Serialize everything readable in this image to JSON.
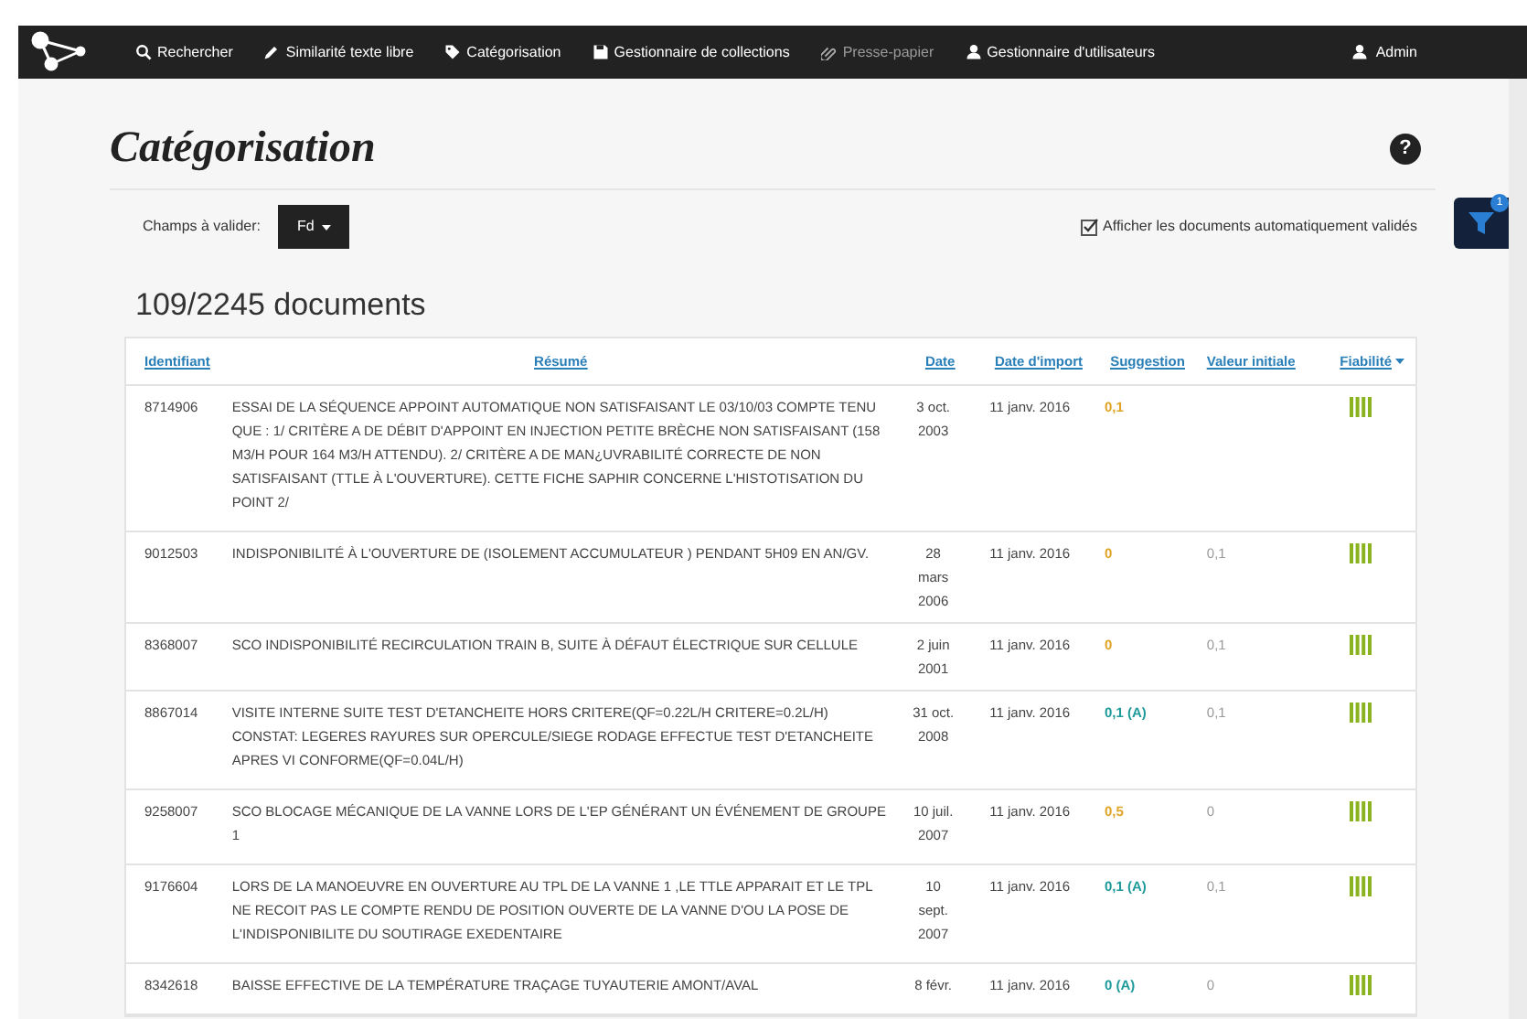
{
  "nav": {
    "items": [
      {
        "label": "Rechercher",
        "disabled": false
      },
      {
        "label": "Similarité texte libre",
        "disabled": false
      },
      {
        "label": "Catégorisation",
        "disabled": false
      },
      {
        "label": "Gestionnaire de collections",
        "disabled": false
      },
      {
        "label": "Presse-papier",
        "disabled": true
      },
      {
        "label": "Gestionnaire d'utilisateurs",
        "disabled": false
      }
    ],
    "user": "Admin"
  },
  "page": {
    "title": "Catégorisation",
    "help": "?"
  },
  "filters": {
    "label": "Champs à valider:",
    "dropdown": "Fd",
    "auto_validated": {
      "label": "Afficher les documents automatiquement validés",
      "checked": true
    }
  },
  "filter_badge": "1",
  "count": "109/2245 documents",
  "table": {
    "columns": [
      "Identifiant",
      "Résumé",
      "Date",
      "Date d'import",
      "Suggestion",
      "Valeur initiale",
      "Fiabilité"
    ],
    "rows": [
      {
        "id": "8714906",
        "summary": "ESSAI DE LA SÉQUENCE APPOINT AUTOMATIQUE NON SATISFAISANT LE 03/10/03 COMPTE TENU QUE : 1/ CRITÈRE A DE DÉBIT D'APPOINT EN INJECTION PETITE BRÈCHE NON SATISFAISANT (158 M3/H POUR 164 M3/H ATTENDU). 2/ CRITÈRE A DE MAN¿UVRABILITÉ CORRECTE DE NON SATISFAISANT (TTLE À L'OUVERTURE). CETTE FICHE SAPHIR CONCERNE L'HISTOTISATION DU POINT 2/",
        "date": "3 oct. 2003",
        "import": "11 janv. 2016",
        "suggestion": "0,1",
        "color": "#e0a526",
        "initial": null
      },
      {
        "id": "9012503",
        "summary": "INDISPONIBILITÉ À L'OUVERTURE DE (ISOLEMENT ACCUMULATEUR ) PENDANT 5H09 EN AN/GV.",
        "date": "28 mars 2006",
        "import": "11 janv. 2016",
        "suggestion": "0",
        "color": "#e0a526",
        "initial": "0,1"
      },
      {
        "id": "8368007",
        "summary": "SCO INDISPONIBILITÉ RECIRCULATION TRAIN B, SUITE À DÉFAUT ÉLECTRIQUE SUR CELLULE",
        "date": "2 juin 2001",
        "import": "11 janv. 2016",
        "suggestion": "0",
        "color": "#e0a526",
        "initial": "0,1"
      },
      {
        "id": "8867014",
        "summary": "VISITE INTERNE SUITE TEST D'ETANCHEITE HORS CRITERE(QF=0.22L/H CRITERE=0.2L/H) CONSTAT: LEGERES RAYURES SUR OPERCULE/SIEGE RODAGE EFFECTUE TEST D'ETANCHEITE APRES VI CONFORME(QF=0.04L/H)",
        "date": "31 oct. 2008",
        "import": "11 janv. 2016",
        "suggestion": "0,1 (A)",
        "color": "#1f9a9a",
        "initial": "0,1"
      },
      {
        "id": "9258007",
        "summary": "SCO BLOCAGE MÉCANIQUE DE LA VANNE LORS DE L'EP GÉNÉRANT UN ÉVÉNEMENT DE GROUPE 1",
        "date": "10 juil. 2007",
        "import": "11 janv. 2016",
        "suggestion": "0,5",
        "color": "#e0a526",
        "initial": "0"
      },
      {
        "id": "9176604",
        "summary": "LORS DE LA MANOEUVRE EN OUVERTURE AU TPL DE LA VANNE 1 ,LE TTLE APPARAIT ET LE TPL NE RECOIT PAS LE COMPTE RENDU DE POSITION OUVERTE DE LA VANNE D'OU LA POSE DE L'INDISPONIBILITE DU SOUTIRAGE EXEDENTAIRE",
        "date": "10 sept. 2007",
        "import": "11 janv. 2016",
        "suggestion": "0,1 (A)",
        "color": "#1f9a9a",
        "initial": "0,1"
      },
      {
        "id": "8342618",
        "summary": "BAISSE EFFECTIVE DE LA TEMPÉRATURE TRAÇAGE TUYAUTERIE AMONT/AVAL",
        "date": "8 févr.",
        "import": "11 janv. 2016",
        "suggestion": "0 (A)",
        "color": "#1f9a9a",
        "initial": "0"
      }
    ]
  }
}
